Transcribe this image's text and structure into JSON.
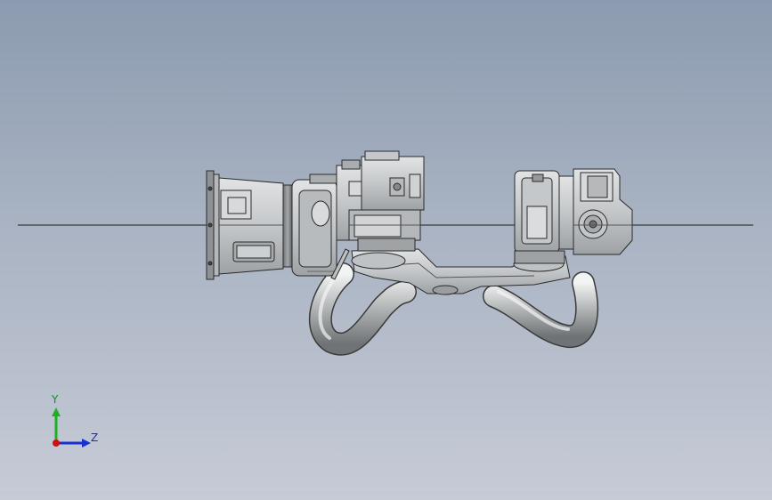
{
  "viewport": {
    "background_top": "#8c9bb0",
    "background_bottom": "#c6cbd6"
  },
  "model": {
    "part_color": "#c9cccf",
    "outline_color": "#2a2a2a",
    "pipe_color": "#b9bcbd"
  },
  "triad": {
    "y_label": "Y",
    "z_label": "Z",
    "y_color": "#1fb020",
    "z_color": "#1a2fd0",
    "x_color": "#d01010"
  }
}
